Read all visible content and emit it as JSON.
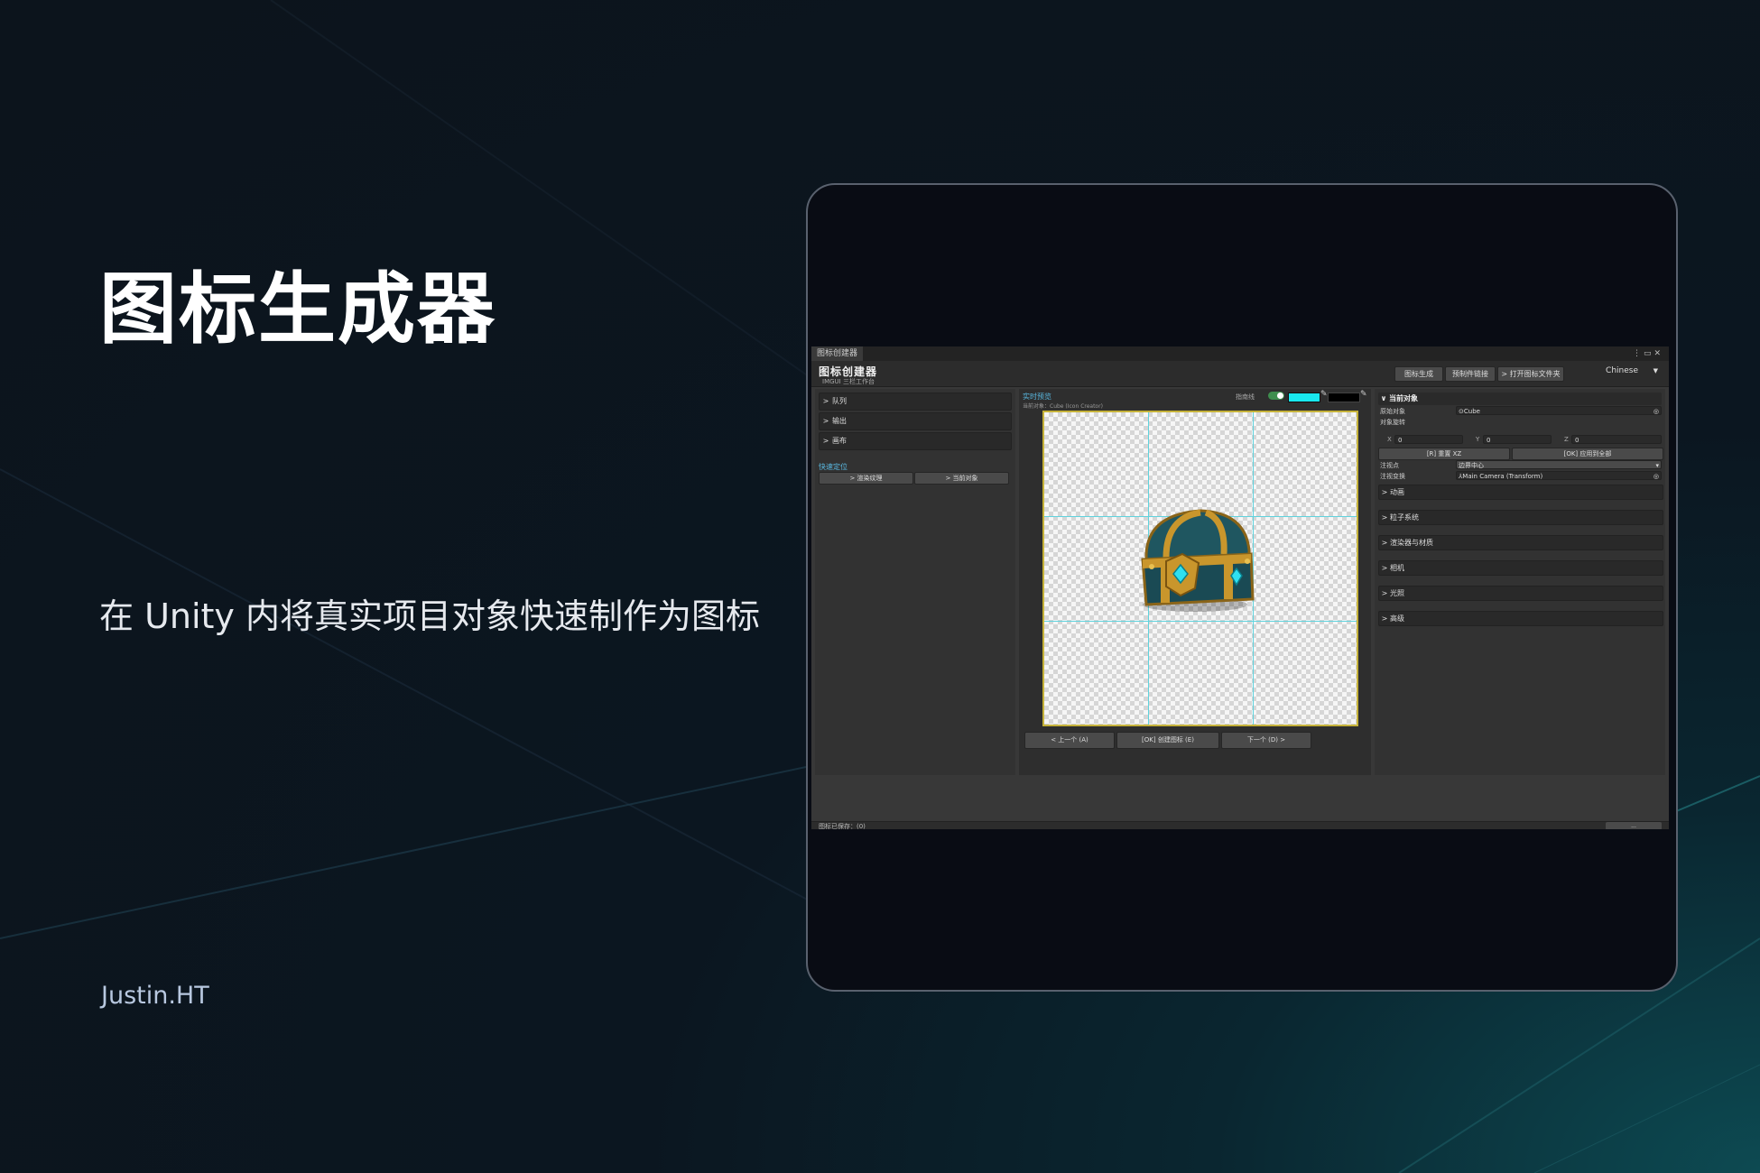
{
  "hero": {
    "title": "图标生成器",
    "subtitle": "在 Unity 内将真实项目对象快速制作为图标",
    "author": "Justin.HT"
  },
  "window": {
    "tab_label": "图标创建器",
    "title": "图标创建器",
    "subtitle": "IMGUI 三栏工作台",
    "header_buttons": [
      "图标生成",
      "预制件链接",
      "> 打开图标文件夹"
    ],
    "language": "Chinese"
  },
  "left_panel": {
    "sections": [
      {
        "label": "队列"
      },
      {
        "label": "输出"
      },
      {
        "label": "画布"
      }
    ],
    "quick_locate_title": "快速定位",
    "quick_buttons": [
      "> 渲染纹理",
      "> 当前对象"
    ]
  },
  "center_panel": {
    "title": "实时预览",
    "current_object": "当前对象：Cube (Icon Creator)",
    "guide_label": "指南线",
    "guide_enabled": true,
    "guide_color": "#19e8ef",
    "background_color": "#000000",
    "nav_buttons": [
      "< 上一个 (A)",
      "[OK] 创建图标 (E)",
      "下一个 (D) >"
    ]
  },
  "right_panel": {
    "header": "当前对象",
    "source_object_label": "原始对象",
    "source_object_value": "Cube",
    "rotation_label": "对象旋转",
    "axes": [
      {
        "label": "X",
        "value": "0"
      },
      {
        "label": "Y",
        "value": "0"
      },
      {
        "label": "Z",
        "value": "0"
      }
    ],
    "reset_button": "[R] 重置 XZ",
    "apply_all_button": "[OK] 应用到全部",
    "pivot_label": "注视点",
    "pivot_value": "边界中心",
    "pivot_transform_label": "注视变换",
    "pivot_transform_value": "Main Camera (Transform)",
    "sections": [
      {
        "label": "动画"
      },
      {
        "label": "粒子系统"
      },
      {
        "label": "渲染器与材质"
      },
      {
        "label": "相机"
      },
      {
        "label": "光照"
      },
      {
        "label": "高级"
      }
    ]
  },
  "status": {
    "text": "图标已保存：(0)",
    "button": "..."
  },
  "icons": {
    "chevron_right": ">",
    "chevron_down": "∨",
    "target": "◎",
    "object": "⊙",
    "transform": "⅄",
    "eyedropper": "✎"
  },
  "colors": {
    "accent_blue": "#59b8e0",
    "canvas_border": "#c5b23a",
    "chest_teal": "#1f5660",
    "chest_gold": "#c9962c",
    "gem": "#2fe0f0"
  }
}
